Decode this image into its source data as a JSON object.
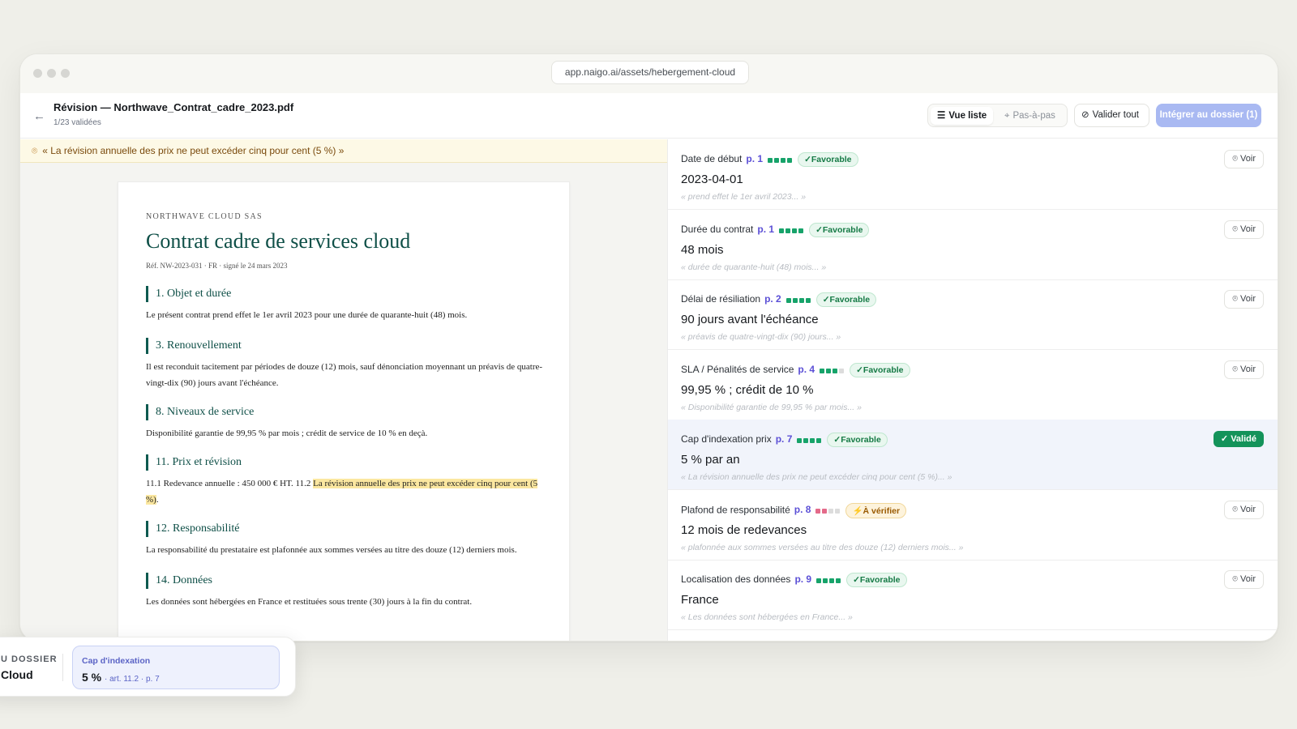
{
  "browser": {
    "url": "app.naigo.ai/assets/hebergement-cloud"
  },
  "header": {
    "back_icon": "arrow-left-icon",
    "title": "Révision — Northwave_Contrat_cadre_2023.pdf",
    "subtitle": "1/23 validées",
    "view_list": "Vue liste",
    "view_step": "Pas-à-pas",
    "validate_all": "Valider tout",
    "integrate": "Intégrer au dossier (1)"
  },
  "quote_bar": {
    "text": "« La révision annuelle des prix ne peut excéder cinq pour cent (5 %) »"
  },
  "document": {
    "company": "NORTHWAVE CLOUD SAS",
    "title": "Contrat cadre de services cloud",
    "ref": "Réf. NW-2023-031 · FR · signé le 24 mars 2023",
    "sections": [
      {
        "heading": "1. Objet et durée",
        "body": "Le présent contrat prend effet le 1er avril 2023 pour une durée de quarante-huit (48) mois."
      },
      {
        "heading": "3. Renouvellement",
        "body": "Il est reconduit tacitement par périodes de douze (12) mois, sauf dénonciation moyennant un préavis de quatre-vingt-dix (90) jours avant l'échéance."
      },
      {
        "heading": "8. Niveaux de service",
        "body": "Disponibilité garantie de 99,95 % par mois ; crédit de service de 10 % en deçà."
      },
      {
        "heading": "11. Prix et révision",
        "body_before": "11.1 Redevance annuelle : 450 000 € HT. 11.2 ",
        "body_highlight": "La révision annuelle des prix ne peut excéder cinq pour cent (5 %)",
        "body_after": "."
      },
      {
        "heading": "12. Responsabilité",
        "body": "La responsabilité du prestataire est plafonnée aux sommes versées au titre des douze (12) derniers mois."
      },
      {
        "heading": "14. Données",
        "body": "Les données sont hébergées en France et restituées sous trente (30) jours à la fin du contrat."
      }
    ]
  },
  "fields": [
    {
      "label": "Date de début",
      "page": "p. 1",
      "confidence": 4,
      "badge": "Favorable",
      "value": "2023-04-01",
      "quote": "« prend effet le 1er avril 2023... »",
      "action": "Voir"
    },
    {
      "label": "Durée du contrat",
      "page": "p. 1",
      "confidence": 4,
      "badge": "Favorable",
      "value": "48 mois",
      "quote": "« durée de quarante-huit (48) mois... »",
      "action": "Voir"
    },
    {
      "label": "Délai de résiliation",
      "page": "p. 2",
      "confidence": 4,
      "badge": "Favorable",
      "value": "90 jours avant l'échéance",
      "quote": "« préavis de quatre-vingt-dix (90) jours... »",
      "action": "Voir"
    },
    {
      "label": "SLA / Pénalités de service",
      "page": "p. 4",
      "confidence": 3,
      "badge": "Favorable",
      "value": "99,95 % ; crédit de 10 %",
      "quote": "« Disponibilité garantie de 99,95 % par mois... »",
      "action": "Voir"
    },
    {
      "label": "Cap d'indexation prix",
      "page": "p. 7",
      "confidence": 4,
      "badge": "Favorable",
      "value": "5 % par an",
      "quote": "« La révision annuelle des prix ne peut excéder cinq pour cent (5 %)... »",
      "action": "Validé"
    },
    {
      "label": "Plafond de responsabilité",
      "page": "p. 8",
      "confidence": 2,
      "badge": "À vérifier",
      "value": "12 mois de redevances",
      "quote": "« plafonnée aux sommes versées au titre des douze (12) derniers mois... »",
      "action": "Voir"
    },
    {
      "label": "Localisation des données",
      "page": "p. 9",
      "confidence": 4,
      "badge": "Favorable",
      "value": "France",
      "quote": "« Les données sont hébergées en France... »",
      "action": "Voir"
    }
  ],
  "floating_card": {
    "label": "U DOSSIER",
    "value": "Cloud",
    "pill_label": "Cap d'indexation",
    "pill_value": "5 %",
    "pill_meta": "· art. 11.2 · p. 7"
  },
  "colors": {
    "accent": "#5b4fd6",
    "primary_button": "#a9b9f2",
    "favorable": "#157a45",
    "validated": "#14935a",
    "doc_heading": "#0e4f47"
  }
}
